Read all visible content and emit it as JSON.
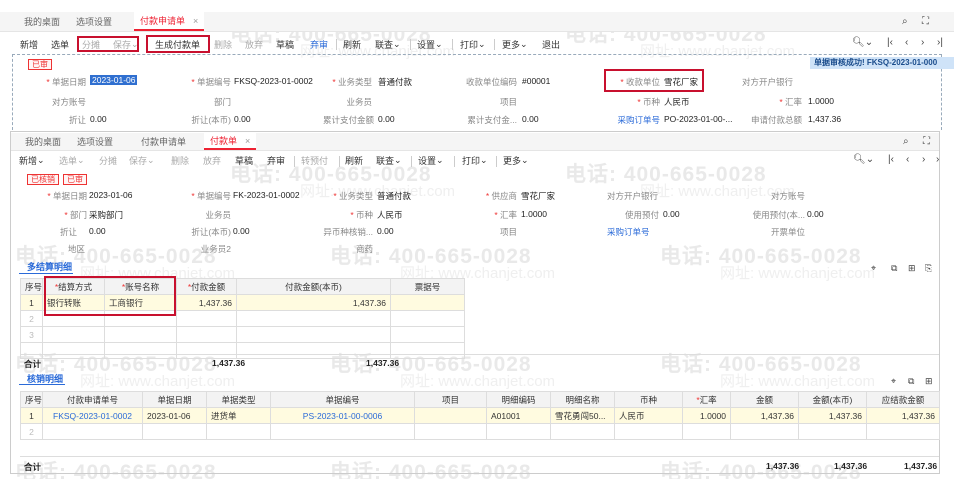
{
  "watermark": {
    "phone": "电话: 400-665-0028",
    "site": "网址: www.chanjet.com"
  },
  "top_window": {
    "tabs": [
      "我的桌面",
      "选项设置",
      "付款申请单"
    ],
    "toolbar": [
      "新增",
      "选单",
      "分摊",
      "保存",
      "生成付款单",
      "删除",
      "放弃",
      "草稿",
      "弃审",
      "刷新",
      "联查",
      "设置",
      "打印",
      "更多",
      "退出"
    ],
    "status_badge": "已审",
    "notice": "单据审核成功! FKSQ-2023-01-000",
    "fields": {
      "doc_date_label": "单据日期",
      "doc_date": "2023-01-06",
      "doc_no_label": "单据编号",
      "doc_no": "FKSQ-2023-01-0002",
      "biz_type_label": "业务类型",
      "biz_type": "普通付款",
      "payee_code_label": "收款单位编码",
      "payee_code": "#00001",
      "payee_label": "收款单位",
      "payee": "雪花厂家",
      "payee_bank_label": "对方开户银行",
      "acct_label": "对方账号",
      "dept_label": "部门",
      "staff_label": "业务员",
      "project_label": "项目",
      "currency_label": "币种",
      "currency": "人民币",
      "rate_label": "汇率",
      "rate": "1.0000",
      "discount_label": "折让",
      "discount": "0.00",
      "discount_local_label": "折让(本币)",
      "discount_local": "0.00",
      "accum_paid_label": "累计支付金额",
      "accum_paid": "0.00",
      "accum_paid2_label": "累计支付金...",
      "accum_paid2": "0.00",
      "po_label": "采购订单号",
      "po": "PO-2023-01-00-...",
      "apply_total_label": "申请付款总额",
      "apply_total": "1,437.36"
    }
  },
  "bottom_window": {
    "tabs": [
      "我的桌面",
      "选项设置",
      "付款申请单",
      "付款单"
    ],
    "toolbar": [
      "新增",
      "选单",
      "分摊",
      "保存",
      "删除",
      "放弃",
      "草稿",
      "弃审",
      "转预付",
      "刷新",
      "联查",
      "设置",
      "打印",
      "更多"
    ],
    "badges": [
      "已核销",
      "已审"
    ],
    "fields": {
      "doc_date_label": "单据日期",
      "doc_date": "2023-01-06",
      "doc_no_label": "单据编号",
      "doc_no": "FK-2023-01-0002",
      "biz_type_label": "业务类型",
      "biz_type": "普通付款",
      "supplier_label": "供应商",
      "supplier": "雪花厂家",
      "bank_label": "对方开户银行",
      "acct_label": "对方账号",
      "dept_label": "部门",
      "dept": "采购部门",
      "staff_label": "业务员",
      "currency_label": "币种",
      "currency": "人民币",
      "rate_label": "汇率",
      "rate": "1.0000",
      "prepay_label": "使用预付",
      "prepay": "0.00",
      "prepay_local_label": "使用预付(本...",
      "prepay_local": "0.00",
      "discount_label": "折让",
      "discount": "0.00",
      "discount_local_label": "折让(本币)",
      "discount_local": "0.00",
      "fx_label": "异币种核销...",
      "fx": "0.00",
      "project_label": "项目",
      "po_label": "采购订单号",
      "bank_branch_label": "开票单位",
      "region_label": "地区",
      "staff2_label": "业务员2",
      "store_label": "商药"
    },
    "settle": {
      "title": "多结算明细",
      "headers": [
        "序号",
        "结算方式",
        "账号名称",
        "付款金额",
        "付款金额(本币)",
        "票据号"
      ],
      "rows": [
        [
          "1",
          "银行转账",
          "工商银行",
          "1,437.36",
          "1,437.36",
          ""
        ],
        [
          "2",
          "",
          "",
          "",
          "",
          ""
        ],
        [
          "3",
          "",
          "",
          "",
          "",
          ""
        ]
      ],
      "total_label": "合计",
      "total": "1,437.36",
      "total_local": "1,437.36"
    },
    "writeoff": {
      "title": "核销明细",
      "headers": [
        "序号",
        "付款申请单号",
        "单据日期",
        "单据类型",
        "单据编号",
        "项目",
        "明细编码",
        "明细名称",
        "币种",
        "汇率",
        "金额",
        "金额(本币)",
        "应结款金额"
      ],
      "rows": [
        [
          "1",
          "FKSQ-2023-01-0002",
          "2023-01-06",
          "进货单",
          "PS-2023-01-00-0006",
          "",
          "A01001",
          "雪花勇闯50...",
          "人民币",
          "1.0000",
          "1,437.36",
          "1,437.36",
          "1,437.36"
        ],
        [
          "2",
          "",
          "",
          "",
          "",
          "",
          "",
          "",
          "",
          "",
          "",
          "",
          ""
        ]
      ],
      "total_label": "合计",
      "total": "1,437.36",
      "total_local": "1,437.36",
      "total_due": "1,437.36"
    }
  }
}
